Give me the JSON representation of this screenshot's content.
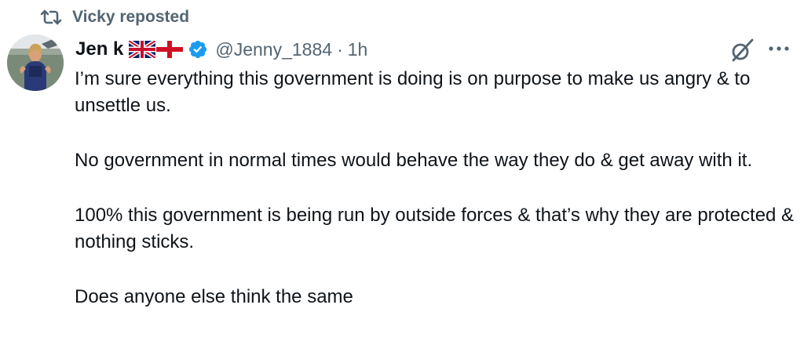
{
  "repost": {
    "text": "Vicky reposted",
    "icon": "repost-icon"
  },
  "author": {
    "display_name": "Jen k",
    "flags": [
      "uk-flag-icon",
      "england-flag-icon"
    ],
    "verified_icon": "verified-badge-icon",
    "verified_color": "#1d9bf0",
    "handle": "@Jenny_1884",
    "separator": "·",
    "time": "1h",
    "avatar_icon": "avatar"
  },
  "actions": {
    "grok_icon": "grok-icon",
    "more_icon": "more-options-icon"
  },
  "tweet": {
    "paragraphs": [
      "I’m sure everything this government is doing is on purpose to make us angry & to unsettle us.",
      "No government in normal times would behave the way they do & get away with it.",
      "100% this government is being run by outside forces & that’s why they are protected & nothing sticks.",
      "Does anyone else think the same"
    ]
  },
  "colors": {
    "text_primary": "#0f1419",
    "text_secondary": "#536471",
    "accent": "#1d9bf0"
  }
}
